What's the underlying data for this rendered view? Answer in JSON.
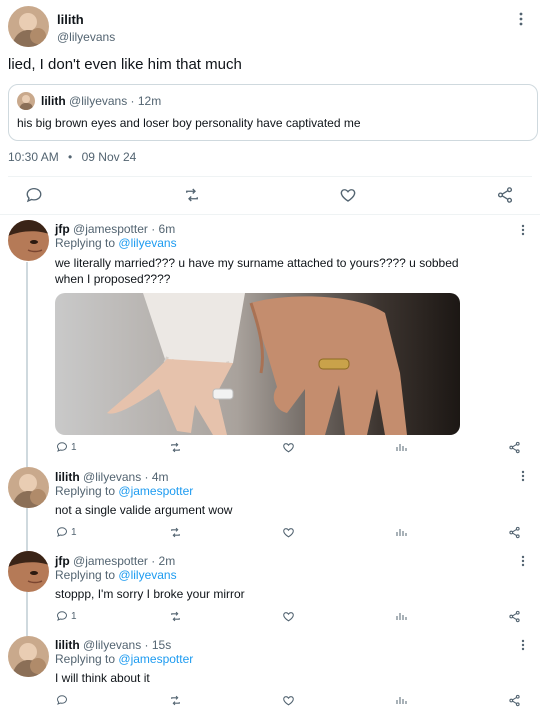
{
  "main_tweet": {
    "name": "lilith",
    "handle": "@lilyevans",
    "text": "lied, I don't even like him that much",
    "quote": {
      "name": "lilith",
      "meta": "@lilyevans · 12m",
      "text": "his big brown eyes and loser boy personality have captivated me"
    },
    "time": "10:30 AM",
    "date": "09 Nov 24"
  },
  "replies": [
    {
      "name": "jfp",
      "meta": "@jamespotter · 6m",
      "replying_prefix": "Replying to",
      "replying_to": "@lilyevans",
      "text": "we literally married??? u have my surname attached to yours???? u sobbed when I proposed????",
      "reply_count": "1"
    },
    {
      "name": "lilith",
      "meta": "@lilyevans · 4m",
      "replying_prefix": "Replying to",
      "replying_to": "@jamespotter",
      "text": "not a single valide argument wow",
      "reply_count": "1"
    },
    {
      "name": "jfp",
      "meta": "@jamespotter · 2m",
      "replying_prefix": "Replying to",
      "replying_to": "@lilyevans",
      "text": "stoppp, I'm sorry I broke your mirror",
      "reply_count": "1"
    },
    {
      "name": "lilith",
      "meta": "@lilyevans · 15s",
      "replying_prefix": "Replying to",
      "replying_to": "@jamespotter",
      "text": "I will think about it",
      "reply_count": ""
    }
  ],
  "icons": {
    "more": "more-vertical-icon",
    "reply": "reply-bubble-icon",
    "retweet": "retweet-icon",
    "like": "heart-icon",
    "share": "share-icon",
    "views": "views-bar-chart-icon"
  },
  "colors": {
    "link": "#1d9bf0",
    "secondary_text": "#536471",
    "divider": "#eff3f4"
  }
}
